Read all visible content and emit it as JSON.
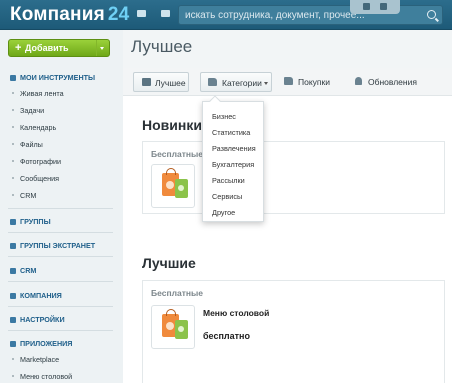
{
  "header": {
    "logo_text": "Компания",
    "logo_number": "24",
    "search_placeholder": "искать сотрудника, документ, прочее..."
  },
  "sidebar": {
    "add_button": "Добавить",
    "my_tools": "МОИ ИНСТРУМЕНТЫ",
    "tool_items": [
      "Живая лента",
      "Задачи",
      "Календарь",
      "Файлы",
      "Фотографии",
      "Сообщения",
      "CRM"
    ],
    "groups": "ГРУППЫ",
    "extranet_groups": "ГРУППЫ ЭКСТРАНЕТ",
    "crm": "CRM",
    "company": "КОМПАНИЯ",
    "settings": "НАСТРОЙКИ",
    "apps": "ПРИЛОЖЕНИЯ",
    "app_items": [
      "Marketplace",
      "Меню столовой"
    ]
  },
  "main": {
    "page_title": "Лучшее",
    "tabs": [
      {
        "label": "Лучшее",
        "icon": "store-icon"
      },
      {
        "label": "Категории",
        "icon": "folder-icon"
      },
      {
        "label": "Покупки",
        "icon": "folder-icon"
      },
      {
        "label": "Обновления",
        "icon": "bell-icon"
      }
    ],
    "section_new": "Новинки",
    "section_best": "Лучшие",
    "card_head": "Бесплатные",
    "card2_head": "Бесплатные",
    "app_name": "Меню столовой",
    "app_price": "бесплатно",
    "card1_app_name": "...",
    "card1_app_price": "...",
    "categories_dropdown": [
      "Бизнес",
      "Статистика",
      "Развлечения",
      "Бухгалтерия",
      "Рассылки",
      "Сервисы",
      "Другое"
    ]
  }
}
